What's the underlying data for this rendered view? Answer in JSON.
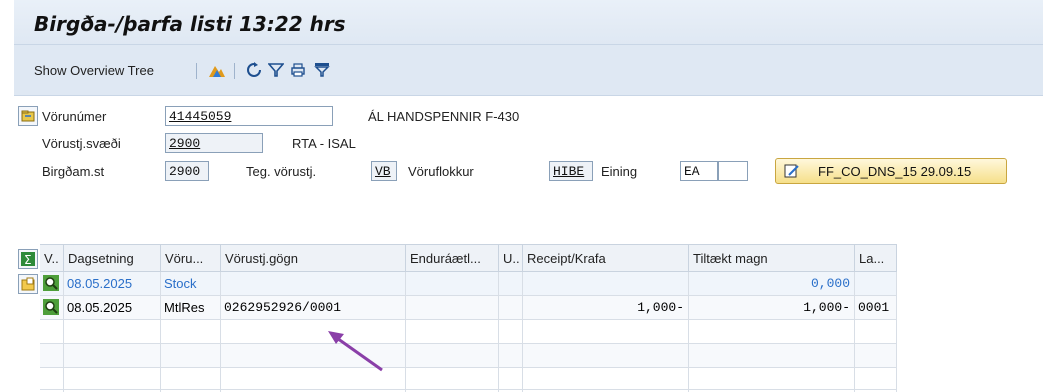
{
  "window": {
    "title": "Birgða-/þarfa listi 13:22 hrs"
  },
  "toolbar": {
    "show_overview_label": "Show Overview Tree"
  },
  "header": {
    "material_label": "Vörunúmer",
    "material_value": "41445059",
    "material_desc": "ÁL HANDSPENNIR F-430",
    "mrp_area_label": "Vörustj.svæði",
    "mrp_area_value": "2900",
    "mrp_area_desc": "RTA - ISAL",
    "plant_label": "Birgðam.st",
    "plant_value": "2900",
    "mrp_type_label": "Teg. vörustj.",
    "mrp_type_value": "VB",
    "mat_type_label": "Vöruflokkur",
    "mat_type_value": "HIBE",
    "unit_label": "Eining",
    "unit_value": "EA",
    "unit_extra": "",
    "user_button_label": "FF_CO_DNS_15 29.09.15"
  },
  "grid": {
    "columns": [
      "V..",
      "Dagsetning",
      "Vöru...",
      "Vörustj.gögn",
      "Enduráætl...",
      "U..",
      "Receipt/Krafa",
      "Tiltækt magn",
      "La..."
    ],
    "rows": [
      {
        "date": "08.05.2025",
        "element": "Stock",
        "data": "",
        "resched": "",
        "u": "",
        "receipt": "",
        "available": "0,000",
        "la": ""
      },
      {
        "date": "08.05.2025",
        "element": "MtlRes",
        "data": "0262952926/0001",
        "resched": "",
        "u": "",
        "receipt": "1,000-",
        "available": "1,000-",
        "la": "0001"
      }
    ]
  },
  "colors": {
    "arrow": "#8a3fa8",
    "link_blue": "#2a6fc9"
  }
}
